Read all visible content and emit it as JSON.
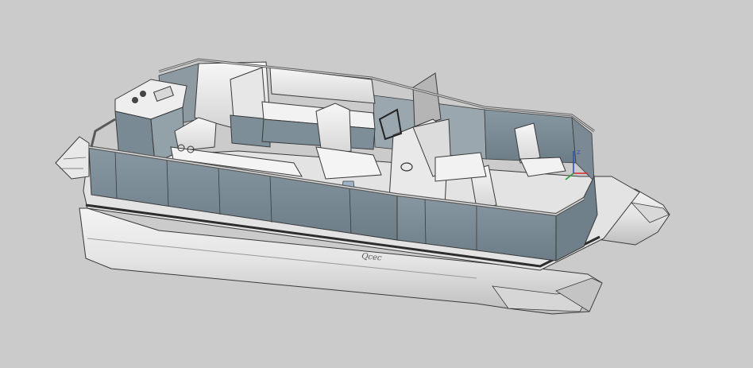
{
  "viewport": {
    "background_color": "#cbcbcb",
    "panel_color": "#7b8c96",
    "hull_color": "#eeeeee",
    "outline_color": "#3a3a3a"
  },
  "model": {
    "hull_signature": "Qcec"
  },
  "triad": {
    "x_color": "#d9272e",
    "y_color": "#2e9b3a",
    "z_color": "#2a56c8",
    "z_label": "Z"
  }
}
